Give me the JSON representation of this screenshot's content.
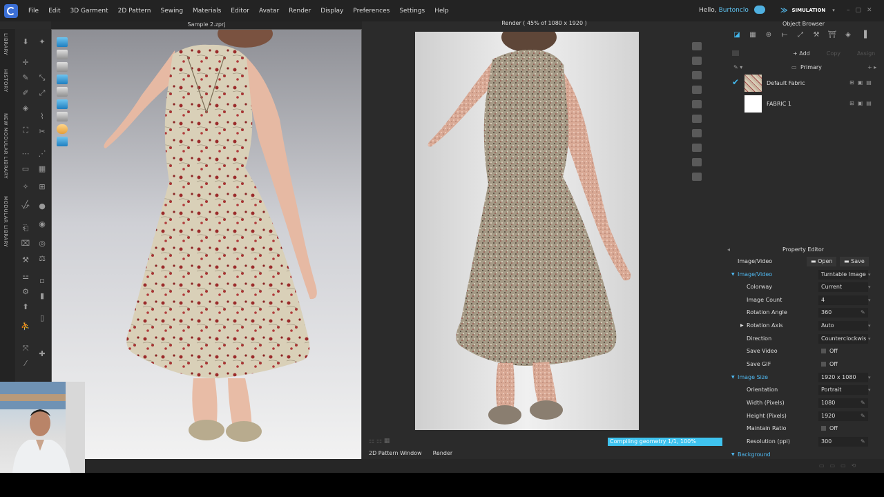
{
  "menubar": {
    "items": [
      "File",
      "Edit",
      "3D Garment",
      "2D Pattern",
      "Sewing",
      "Materials",
      "Editor",
      "Avatar",
      "Render",
      "Display",
      "Preferences",
      "Settings",
      "Help"
    ],
    "greeting": "Hello,",
    "username": "Burtonclo",
    "mode_label": "SIMULATION"
  },
  "sidebar": {
    "tabs": [
      "LIBRARY",
      "HISTORY",
      "NEW MODULAR LIBRARY",
      "MODULAR LIBRARY"
    ]
  },
  "viewport3d": {
    "title": "Sample 2.zprj"
  },
  "render_window": {
    "title": "Render ( 45% of 1080 x 1920 )"
  },
  "progress": {
    "label": "Compiling geometry 1/1, 100%",
    "percent": 100
  },
  "bottom_tabs": [
    "2D Pattern Window",
    "Render"
  ],
  "object_browser": {
    "title": "Object Browser",
    "add_label": "+ Add",
    "copy_label": "Copy",
    "assign_label": "Assign",
    "colorway": "Primary",
    "fabrics": [
      {
        "name": "Default Fabric",
        "selected": true,
        "swatch_color": "#c9b8a3"
      },
      {
        "name": "FABRIC 1",
        "selected": false,
        "swatch_color": "#ffffff"
      }
    ]
  },
  "property_editor": {
    "title": "Property Editor",
    "section_label": "Image/Video",
    "open_label": "Open",
    "save_label": "Save",
    "rows": [
      {
        "label": "Image/Video",
        "value": "Turntable Image",
        "type": "section"
      },
      {
        "label": "Colorway",
        "value": "Current",
        "type": "select"
      },
      {
        "label": "Image Count",
        "value": "4",
        "type": "select"
      },
      {
        "label": "Rotation Angle",
        "value": "360",
        "type": "edit"
      },
      {
        "label": "Rotation Axis",
        "value": "Auto",
        "type": "select"
      },
      {
        "label": "Direction",
        "value": "Counterclockwis",
        "type": "select"
      },
      {
        "label": "Save Video",
        "value": "Off",
        "type": "check"
      },
      {
        "label": "Save GIF",
        "value": "Off",
        "type": "check"
      },
      {
        "label": "Image Size",
        "value": "1920 x 1080",
        "type": "section"
      },
      {
        "label": "Orientation",
        "value": "Portrait",
        "type": "select"
      },
      {
        "label": "Width (Pixels)",
        "value": "1080",
        "type": "edit"
      },
      {
        "label": "Height (Pixels)",
        "value": "1920",
        "type": "edit"
      },
      {
        "label": "Maintain Ratio",
        "value": "Off",
        "type": "check"
      },
      {
        "label": "Resolution (ppi)",
        "value": "300",
        "type": "edit"
      }
    ],
    "background_label": "Background"
  },
  "colors": {
    "accent": "#3fc3ef",
    "panel": "#2b2b2b",
    "menubar": "#232323"
  }
}
